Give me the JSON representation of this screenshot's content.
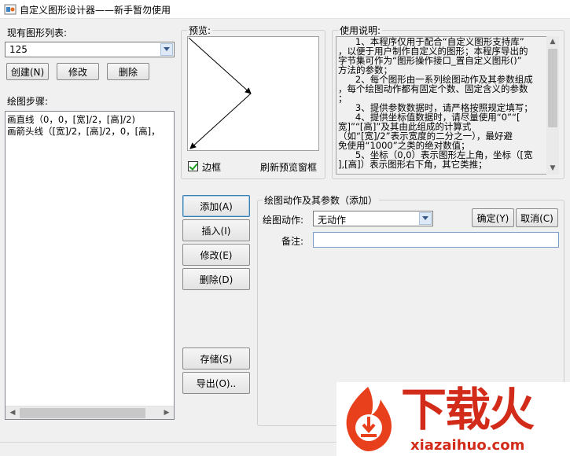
{
  "window": {
    "title": "自定义图形设计器——新手暂勿使用"
  },
  "left": {
    "list_label": "现有图形列表:",
    "combo_value": "125",
    "create_label": "创建(N)",
    "modify_label": "修改",
    "delete_label": "删除",
    "steps_label": "绘图步骤:",
    "steps": [
      "画直线（0，0，[宽]/2，[高]/2)",
      "画箭头线（[宽]/2，[高]/2，0，[高]，"
    ]
  },
  "preview": {
    "title": "预览:",
    "border_label": "边框",
    "refresh_label": "刷新预览窗框",
    "border_checked": true
  },
  "instructions": {
    "title": "使用说明:",
    "lines": [
      "      1、本程序仅用于配合“自定义图形支持库”",
      "，以便于用户制作自定义的图形；本程序导出的",
      "字节集可作为“图形操作接口_置自定义图形()”",
      "方法的参数；",
      "      2、每个图形由一系列绘图动作及其参数组成",
      "，每个绘图动作都有固定个数、固定含义的参数",
      "；",
      "      3、提供参数数据时，请严格按照规定填写；",
      "      4、提供坐标值数据时，请尽量使用“0”“[",
      "宽]”“[高]”及其由此组成的计算式",
      "（如“[宽]/2”表示宽度的二分之一），最好避",
      "免使用“1000”之类的绝对数值；",
      "      5、坐标（0,0）表示图形左上角，坐标（[宽",
      "],[高]）表示图形右下角，其它类推；"
    ]
  },
  "actions": {
    "add_label": "添加(A)",
    "insert_label": "插入(I)",
    "modify_label": "修改(E)",
    "delete_label": "删除(D)",
    "save_label": "存储(S)",
    "export_label": "导出(O).."
  },
  "params": {
    "group_title": "绘图动作及其参数（添加）",
    "action_label": "绘图动作:",
    "action_value": "无动作",
    "note_label": "备注:",
    "note_value": "",
    "ok_label": "确定(Y)",
    "cancel_label": "取消(C)"
  },
  "watermark": {
    "brand": "下载火",
    "domain": "xiazaihuo.com",
    "color_primary": "#e8401c",
    "color_secondary": "#d22b1a"
  }
}
